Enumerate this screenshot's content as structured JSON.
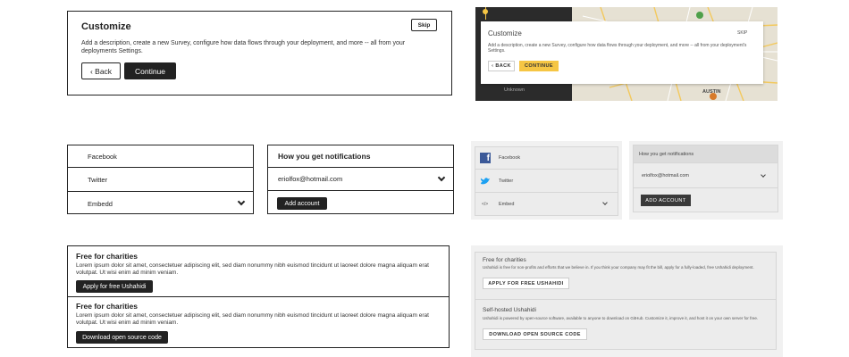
{
  "wireframe_customize": {
    "title": "Customize",
    "skip_label": "Skip",
    "description": "Add a description, create a new Survey, configure how data flows through your deployment, and more -- all from your deployments Settings.",
    "back_label": "‹ Back",
    "continue_label": "Continue"
  },
  "wireframe_social": {
    "items": [
      {
        "label": "Facebook"
      },
      {
        "label": "Twitter"
      },
      {
        "label": "Embedd"
      }
    ]
  },
  "wireframe_notifications": {
    "title": "How you get notifications",
    "email": "eriolfox@hotmail.com",
    "add_account_label": "Add account"
  },
  "wireframe_plans": {
    "items": [
      {
        "title": "Free for charities",
        "description": "Lorem ipsum dolor sit amet, consectetuer adipiscing elit, sed diam nonummy nibh euismod tincidunt ut laoreet dolore magna aliquam erat volutpat. Ut wisi enim ad minim veniam.",
        "button_label": "Apply for free Ushahidi"
      },
      {
        "title": "Free for charities",
        "description": "Lorem ipsum dolor sit amet, consectetuer adipiscing elit, sed diam nonummy nibh euismod tincidunt ut laoreet dolore magna aliquam erat volutpat. Ut wisi enim ad minim veniam.",
        "button_label": "Download open source code"
      }
    ]
  },
  "mockup_customize": {
    "title": "Customize",
    "skip_label": "SKIP",
    "description": "Add a description, create a new Survey, configure how data flows through your deployment, and more -- all from your deployment's Settings.",
    "back_label": "‹ BACK",
    "continue_label": "CONTINUE",
    "sidebar_item": "Unknown",
    "map_label": "AUSTIN"
  },
  "mockup_social": {
    "items": [
      {
        "label": "Facebook",
        "icon": "facebook-icon"
      },
      {
        "label": "Twitter",
        "icon": "twitter-icon"
      },
      {
        "label": "Embed",
        "icon": "embed-icon"
      }
    ]
  },
  "mockup_notifications": {
    "title": "How you get notifications",
    "email": "eriolfox@hotmail.com",
    "add_account_label": "ADD ACCOUNT"
  },
  "mockup_plans": {
    "items": [
      {
        "title": "Free for charities",
        "description": "Ushahidi is free for non-profits and efforts that we believe in. If you think your company may fit the bill, apply for a fully-loaded, free Ushahidi deployment.",
        "button_label": "APPLY FOR FREE USHAHIDI"
      },
      {
        "title": "Self-hosted Ushahidi",
        "description": "Ushahidi is powered by open-source software, available to anyone to download on GitHub. Customize it, improve it, and host it on your own server for free.",
        "button_label": "DOWNLOAD OPEN SOURCE CODE"
      }
    ]
  },
  "colors": {
    "accent_yellow": "#f6c644",
    "dark": "#222222",
    "facebook": "#3b5998",
    "twitter": "#1da1f2"
  }
}
